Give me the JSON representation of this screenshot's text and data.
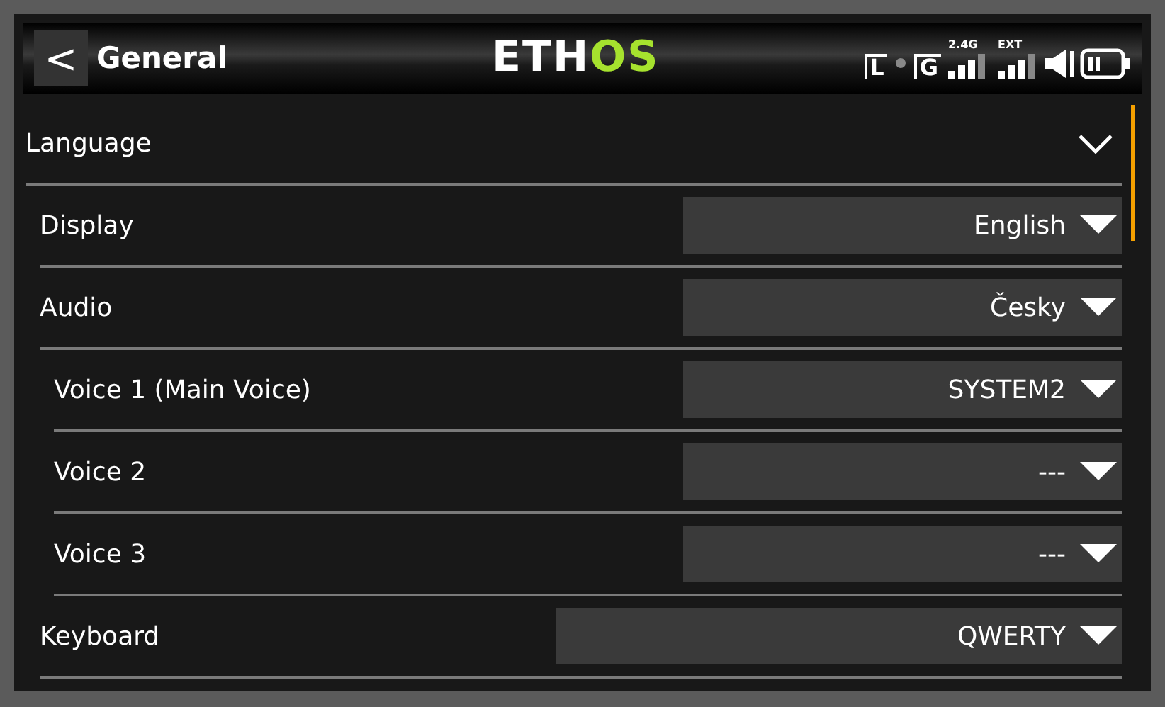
{
  "header": {
    "back": "<",
    "title": "General",
    "logo": [
      {
        "text": "ETH",
        "accent": false
      },
      {
        "text": "OS",
        "accent": true
      }
    ],
    "status": {
      "local": "L",
      "global": "G",
      "band_a": "2.4G",
      "band_b": "EXT"
    }
  },
  "section": {
    "label": "Language",
    "expanded": true,
    "children": [
      {
        "label": "Display",
        "kind": "select",
        "value": "English"
      },
      {
        "label": "Audio",
        "kind": "select",
        "value": "Česky",
        "children": [
          {
            "label": "Voice 1 (Main Voice)",
            "kind": "select",
            "value": "SYSTEM2"
          },
          {
            "label": "Voice 2",
            "kind": "select",
            "value": "---"
          },
          {
            "label": "Voice 3",
            "kind": "select",
            "value": "---"
          }
        ]
      },
      {
        "label": "Keyboard",
        "kind": "wide-select",
        "value": "QWERTY"
      }
    ]
  }
}
